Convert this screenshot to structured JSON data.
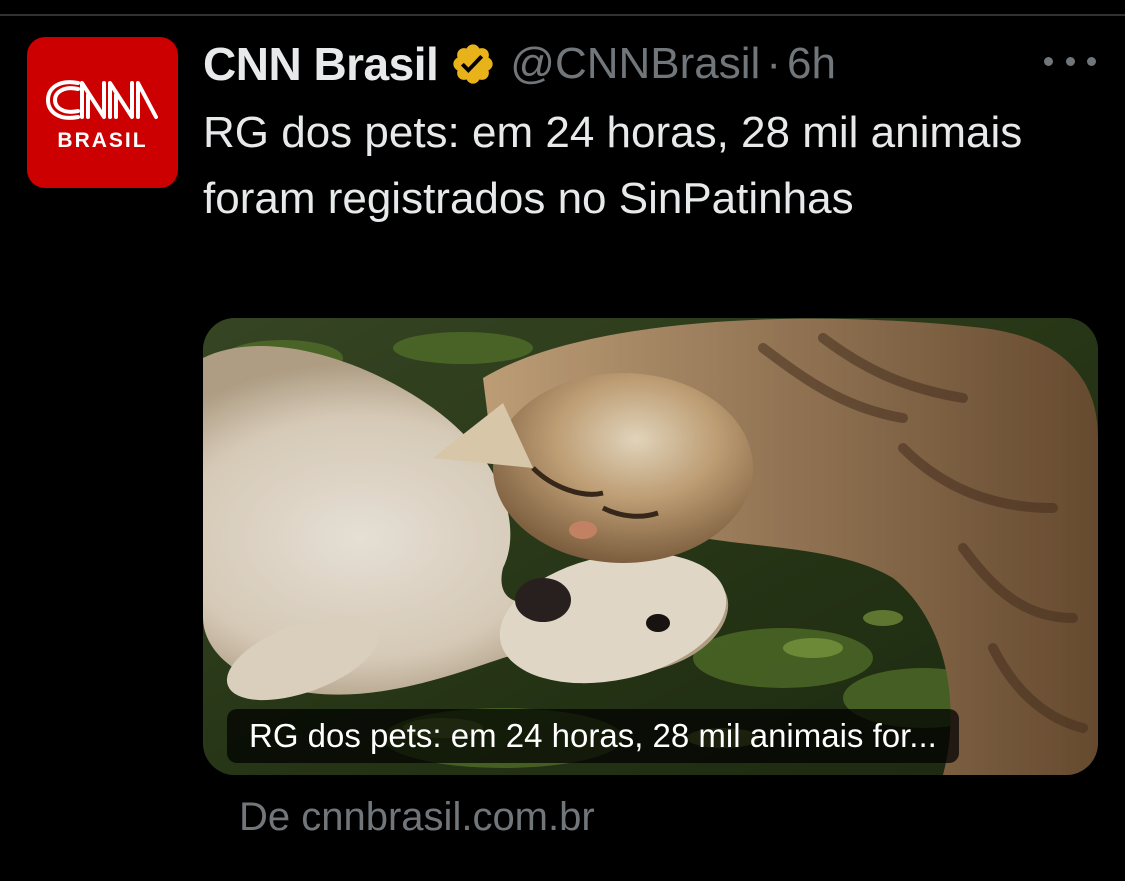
{
  "tweet": {
    "author": {
      "name": "CNN Brasil",
      "handle": "@CNNBrasil",
      "verified_color": "#e8b21b",
      "avatar": {
        "logo_text": "CNN",
        "logo_sub": "BRASIL",
        "bg_color": "#cc0000"
      }
    },
    "separator": "·",
    "timestamp": "6h",
    "text": "RG dos pets: em 24 horas, 28 mil animais foram registrados no SinPatinhas",
    "card": {
      "image_alt": "cat-and-dog-lying-on-grass",
      "caption": "RG dos pets: em 24 horas, 28 mil animais for..."
    },
    "source": "De cnnbrasil.com.br"
  },
  "icons": {
    "verified": "verified-badge-icon",
    "more": "more-options-icon"
  }
}
